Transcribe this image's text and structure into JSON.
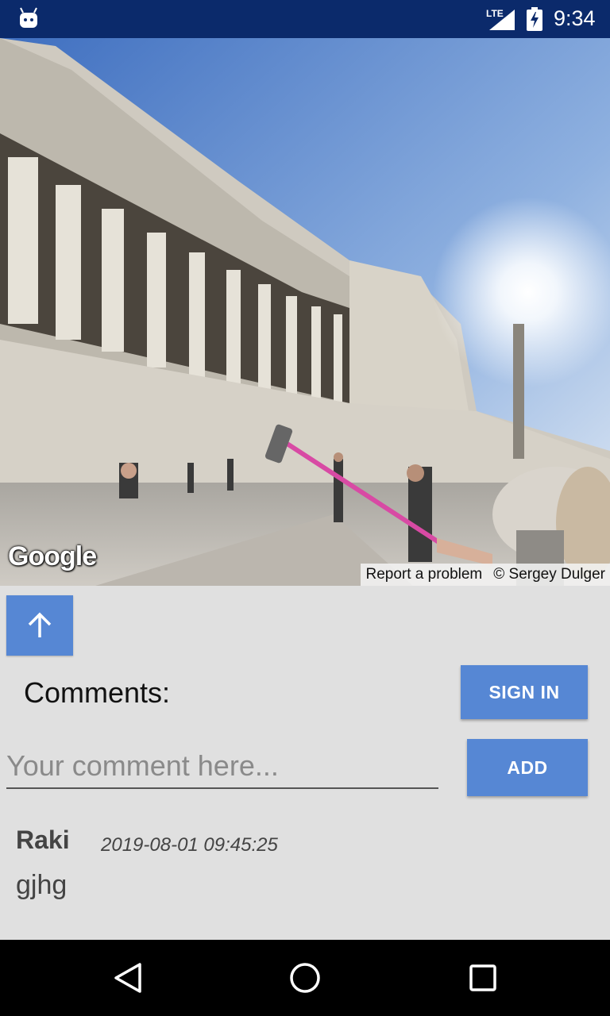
{
  "status_bar": {
    "network": "LTE",
    "time": "9:34",
    "icons": [
      "android-icon",
      "signal-icon",
      "battery-charging-icon"
    ]
  },
  "street_view": {
    "logo": "Google",
    "report_link": "Report a problem",
    "copyright": "© Sergey Dulger"
  },
  "controls": {
    "up_icon": "arrow-up-icon"
  },
  "comments": {
    "title": "Comments:",
    "sign_in_label": "SIGN IN",
    "input_placeholder": "Your comment here...",
    "input_value": "",
    "add_label": "ADD",
    "items": [
      {
        "author": "Raki",
        "timestamp": "2019-08-01 09:45:25",
        "text": "gjhg"
      }
    ]
  },
  "colors": {
    "status_bar": "#0b2a6b",
    "button": "#5687d4",
    "background": "#e0e0e0"
  },
  "nav_bar": {
    "icons": [
      "back-icon",
      "home-icon",
      "recents-icon"
    ]
  }
}
